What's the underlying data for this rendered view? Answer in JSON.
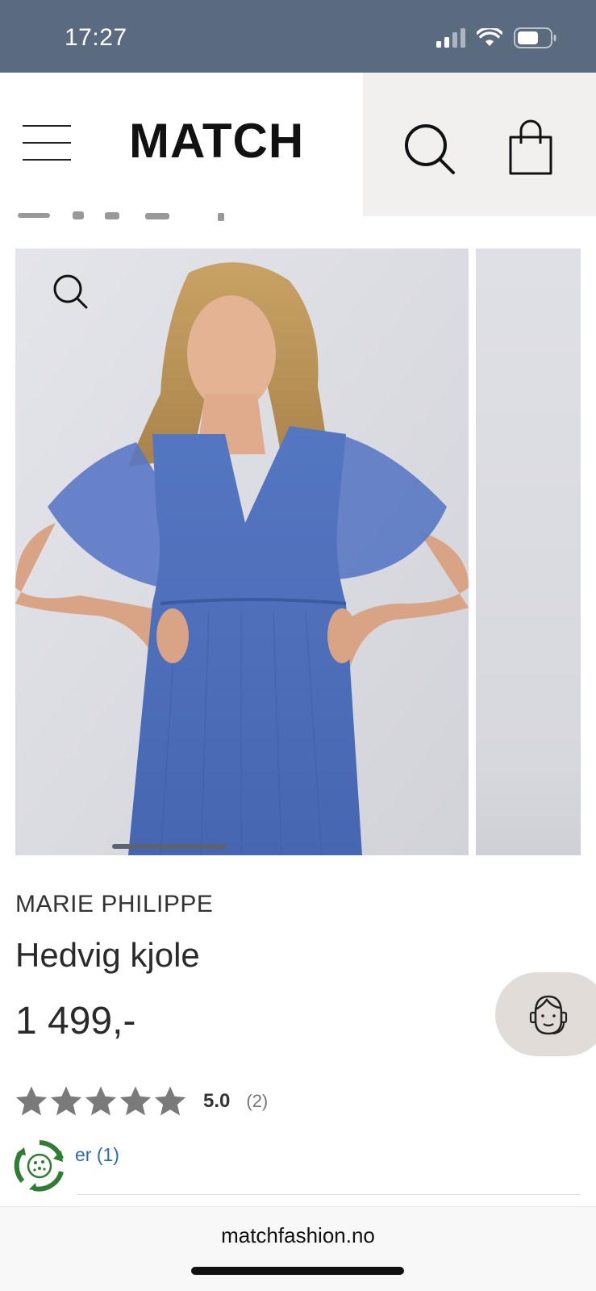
{
  "status_bar": {
    "time": "17:27",
    "icons": [
      "signal-icon",
      "wifi-icon",
      "battery-icon"
    ]
  },
  "header": {
    "logo_text": "MATCH",
    "icons": [
      "menu-icon",
      "search-icon",
      "shopping-bag-icon"
    ]
  },
  "gallery": {
    "zoom_icon": "magnifier-icon",
    "dress_color": "#4b6bb5"
  },
  "product": {
    "brand": "MARIE PHILIPPE",
    "name": "Hedvig kjole",
    "price": "1 499,-"
  },
  "rating": {
    "stars": 5,
    "value": "5.0",
    "count": "(2)",
    "star_color": "#7a7a7a"
  },
  "review_link": "er (1)",
  "browser": {
    "url": "matchfashion.no"
  },
  "colors": {
    "status_bar": "#5a6b80",
    "link": "#2b6db0",
    "chat_bg": "#e1dcd7",
    "eco_green": "#2e7d32"
  }
}
